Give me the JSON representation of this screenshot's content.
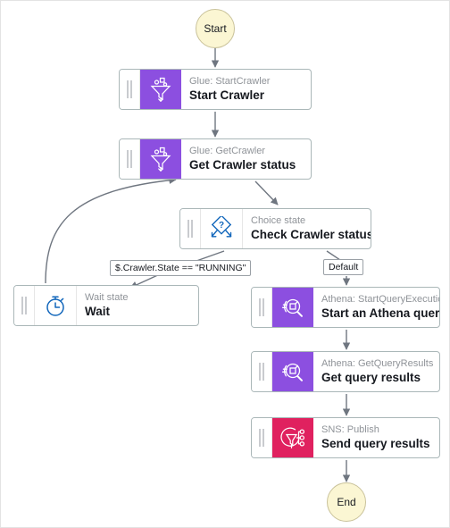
{
  "diagram": {
    "type": "aws-step-functions-state-machine",
    "colors": {
      "purple": "#8c4fe0",
      "crimson": "#e0215f",
      "terminal_fill": "#fbf6d3",
      "terminal_border": "#c9c29a",
      "card_border": "#aab7b8",
      "edge": "#6f7680",
      "choice_icon": "#1166bb",
      "wait_icon": "#1166bb",
      "subtitle": "#8f9398",
      "title": "#16191f",
      "canvas": "#ffffff"
    },
    "start": {
      "label": "Start"
    },
    "end": {
      "label": "End"
    },
    "states": [
      {
        "id": "start-crawler",
        "subtitle": "Glue: StartCrawler",
        "title": "Start Crawler",
        "icon": "glue-funnel-icon",
        "icon_style": "purple"
      },
      {
        "id": "get-crawler",
        "subtitle": "Glue: GetCrawler",
        "title": "Get Crawler status",
        "icon": "glue-funnel-icon",
        "icon_style": "purple"
      },
      {
        "id": "check-crawler-status",
        "subtitle": "Choice state",
        "title": "Check Crawler status",
        "icon": "choice-diamond-question-icon",
        "icon_style": "plain"
      },
      {
        "id": "wait",
        "subtitle": "Wait state",
        "title": "Wait",
        "icon": "stopwatch-icon",
        "icon_style": "plain"
      },
      {
        "id": "start-athena-query",
        "subtitle": "Athena: StartQueryExecution",
        "title": "Start an Athena query",
        "icon": "athena-magnifier-icon",
        "icon_style": "purple"
      },
      {
        "id": "get-query-results",
        "subtitle": "Athena: GetQueryResults",
        "title": "Get query results",
        "icon": "athena-magnifier-icon",
        "icon_style": "purple"
      },
      {
        "id": "send-query-results",
        "subtitle": "SNS: Publish",
        "title": "Send query results",
        "icon": "sns-megaphone-icon",
        "icon_style": "crimson"
      }
    ],
    "edge_labels": {
      "running": "$.Crawler.State == \"RUNNING\"",
      "default": "Default"
    }
  }
}
